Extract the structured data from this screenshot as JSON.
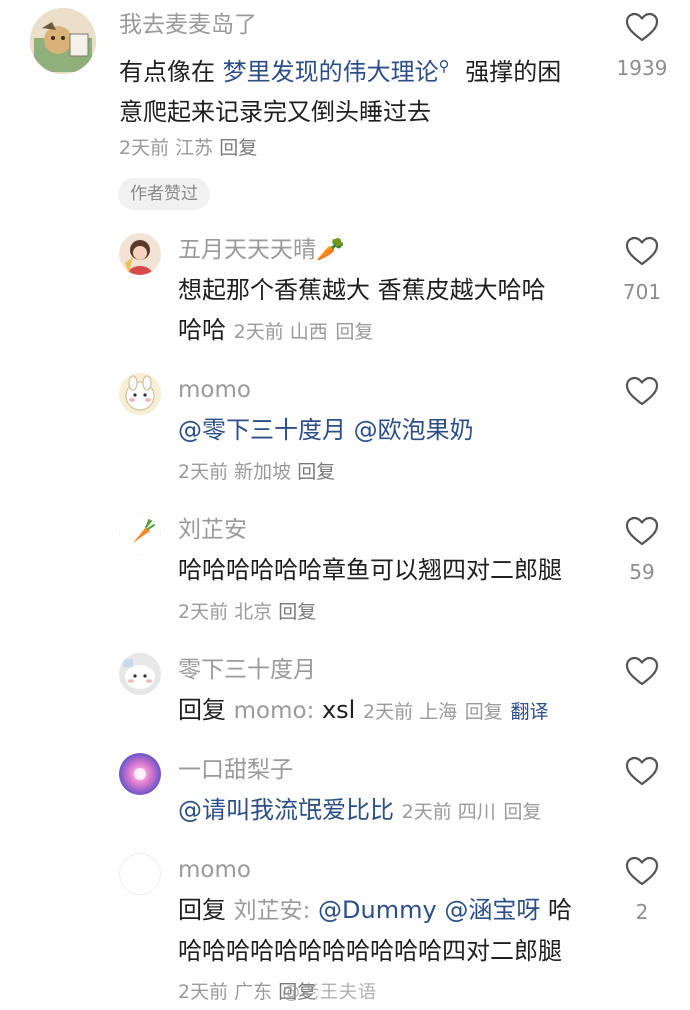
{
  "comments": [
    {
      "user": "我去麦麦岛了",
      "text_plain_before": "有点像在 ",
      "link_text": "梦里发现的伟大理论",
      "text_after_link_line1": " 强撑的困",
      "text_line2": "意爬起来记录完又倒头睡过去",
      "meta": "2天前 江苏",
      "reply_label": "回复",
      "likes": "1939",
      "badge": "作者赞过"
    },
    {
      "user": "五月天天天晴",
      "user_emoji": "🥕",
      "text_line1": "想起那个香蕉越大 香蕉皮越大哈哈",
      "text_line2_start": "哈哈 ",
      "meta": "2天前 山西",
      "reply_label": "回复",
      "likes": "701"
    },
    {
      "user": "momo",
      "mention1": "@零下三十度月",
      "mention2": "@欧泡果奶",
      "meta": "2天前 新加坡",
      "reply_label": "回复",
      "likes": ""
    },
    {
      "user": "刘芷安",
      "text": "哈哈哈哈哈哈章鱼可以翘四对二郎腿",
      "meta": "2天前 北京",
      "reply_label": "回复",
      "likes": "59"
    },
    {
      "user": "零下三十度月",
      "reply_prefix": "回复",
      "reply_to": "momo:",
      "text": " xsl",
      "meta": "2天前 上海",
      "reply_label": "回复",
      "translate_label": "翻译",
      "likes": ""
    },
    {
      "user": "一口甜梨子",
      "mention": "@请叫我流氓爱比比",
      "meta": "2天前 四川",
      "reply_label": "回复",
      "likes": ""
    },
    {
      "user": "momo",
      "reply_prefix": "回复",
      "reply_to": "刘芷安:",
      "mention1": "@Dummy",
      "mention2": "@涵宝呀",
      "text_line1_end": " 哈",
      "text_line2": "哈哈哈哈哈哈哈哈哈哈哈四对二郎腿",
      "meta": "2天前 广东",
      "reply_label": "回复",
      "likes": "2"
    }
  ],
  "watermark": "@老王夫语",
  "icons": {
    "like": "heart-outline-icon",
    "search": "search-icon"
  },
  "colors": {
    "link": "#2c4f88",
    "meta": "#9a9a9a",
    "text": "#1f1f1f"
  }
}
